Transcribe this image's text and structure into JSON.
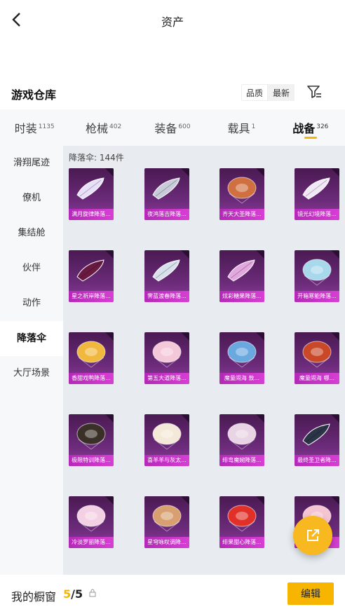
{
  "header": {
    "title": "资产"
  },
  "section": {
    "title": "游戏仓库"
  },
  "sort": {
    "options": [
      "品质",
      "最新"
    ],
    "active": "最新"
  },
  "tabs": [
    {
      "label": "时装",
      "count": "1135",
      "active": false
    },
    {
      "label": "枪械",
      "count": "402",
      "active": false
    },
    {
      "label": "装备",
      "count": "600",
      "active": false
    },
    {
      "label": "载具",
      "count": "1",
      "active": false
    },
    {
      "label": "战备",
      "count": "326",
      "active": true
    }
  ],
  "sidebar": {
    "items": [
      {
        "label": "滑翔尾迹",
        "active": false
      },
      {
        "label": "僚机",
        "active": false
      },
      {
        "label": "集结舱",
        "active": false
      },
      {
        "label": "伙伴",
        "active": false
      },
      {
        "label": "动作",
        "active": false
      },
      {
        "label": "降落伞",
        "active": true
      },
      {
        "label": "大厅场景",
        "active": false
      }
    ]
  },
  "content": {
    "category_count": "降落伞: 144件",
    "items": [
      {
        "name": "满月旋律降落...",
        "icon": "white-wing-glider",
        "color": "#e8e0f8"
      },
      {
        "name": "夜鸿落吉降落...",
        "icon": "silver-wing-glider",
        "color": "#c8ccd8"
      },
      {
        "name": "齐天大圣降落...",
        "icon": "round-parachute",
        "color": "#d07040"
      },
      {
        "name": "镜光幻境降落...",
        "icon": "white-wing-glider",
        "color": "#f0e8f4"
      },
      {
        "name": "星之祈岸降落...",
        "icon": "dark-wing-glider",
        "color": "#6a1a40"
      },
      {
        "name": "霁蓝渡春降落...",
        "icon": "wing-glider",
        "color": "#d8e0ec"
      },
      {
        "name": "炫彩糖果降落...",
        "icon": "pink-wing-glider",
        "color": "#e4a8e0"
      },
      {
        "name": "开箱寒能降落...",
        "icon": "round-parachute",
        "color": "#a8d8ec"
      },
      {
        "name": "香甜戏鸭降落...",
        "icon": "round-parachute",
        "color": "#f0b83c"
      },
      {
        "name": "第五大道降落...",
        "icon": "round-parachute",
        "color": "#f4c8d8"
      },
      {
        "name": "魔童闹海 敖...",
        "icon": "round-parachute",
        "color": "#6aa8e0"
      },
      {
        "name": "魔童闹海 哪...",
        "icon": "round-parachute",
        "color": "#c84828"
      },
      {
        "name": "极限特训降落...",
        "icon": "round-parachute",
        "color": "#3a3028"
      },
      {
        "name": "喜羊羊与灰太...",
        "icon": "character-parachute",
        "color": "#f4e8d8"
      },
      {
        "name": "绯弯魔婉降落...",
        "icon": "round-parachute",
        "color": "#e8d4e4"
      },
      {
        "name": "最终圣卫者降...",
        "icon": "dark-wing-glider",
        "color": "#2c3448"
      },
      {
        "name": "冷淡罗丽降落...",
        "icon": "round-parachute",
        "color": "#f4d0e4"
      },
      {
        "name": "星穹咏叹调降...",
        "icon": "round-parachute",
        "color": "#d8a070"
      },
      {
        "name": "绯果甜心降落...",
        "icon": "apple-parachute",
        "color": "#e03028"
      },
      {
        "name": "",
        "icon": "round-parachute",
        "color": "#f4c4d0"
      }
    ]
  },
  "bottom": {
    "showcase_label": "我的橱窗",
    "showcase_current": "5",
    "showcase_sep_total": "/5",
    "edit_label": "编辑"
  },
  "colors": {
    "accent": "#f7b500",
    "card_purple": "#6a2a78",
    "name_strip": "#c833c5"
  },
  "icons": [
    "back-arrow-icon",
    "filter-icon",
    "share-icon",
    "lock-icon"
  ]
}
